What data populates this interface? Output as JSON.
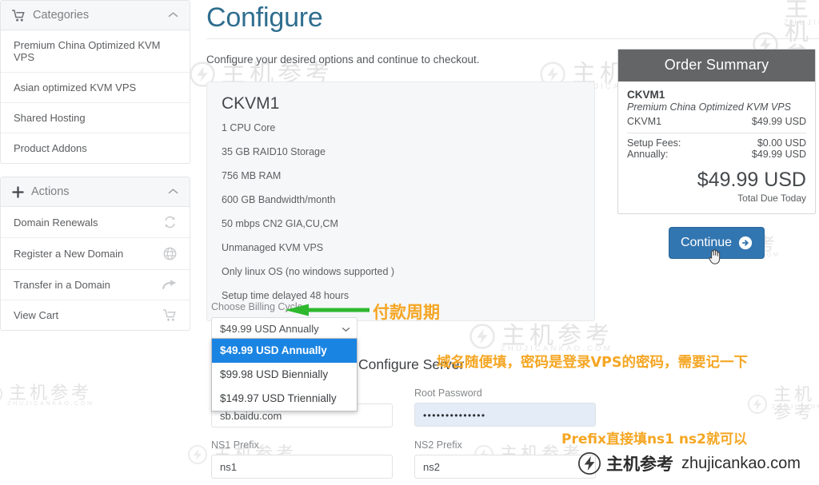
{
  "page": {
    "title": "Configure",
    "subtitle": "Configure your desired options and continue to checkout."
  },
  "sidebar": {
    "categories": {
      "header": "Categories",
      "icon": "cart-icon",
      "collapse_icon": "chevron-up-icon",
      "items": [
        {
          "label": "Premium China Optimized KVM VPS",
          "icon": ""
        },
        {
          "label": "Asian optimized KVM VPS",
          "icon": ""
        },
        {
          "label": "Shared Hosting",
          "icon": ""
        },
        {
          "label": "Product Addons",
          "icon": ""
        }
      ]
    },
    "actions": {
      "header": "Actions",
      "icon": "plus-icon",
      "collapse_icon": "chevron-up-icon",
      "items": [
        {
          "label": "Domain Renewals",
          "icon": "refresh-icon"
        },
        {
          "label": "Register a New Domain",
          "icon": "globe-icon"
        },
        {
          "label": "Transfer in a Domain",
          "icon": "arrow-right-curve-icon"
        },
        {
          "label": "View Cart",
          "icon": "cart-icon"
        }
      ]
    }
  },
  "product": {
    "name": "CKVM1",
    "specs": [
      "1 CPU Core",
      "35 GB RAID10 Storage",
      "756 MB RAM",
      "600 GB Bandwidth/month",
      "50 mbps CN2 GIA,CU,CM",
      "Unmanaged KVM VPS",
      "Only linux OS (no windows supported )",
      "Setup time delayed 48 hours"
    ]
  },
  "billing": {
    "label": "Choose Billing Cycle",
    "selected": "$49.99 USD Annually",
    "caret_icon": "chevron-down-icon",
    "options": [
      "$49.99 USD Annually",
      "$99.98 USD Biennially",
      "$149.97 USD Triennially"
    ]
  },
  "configure_server": {
    "heading": "Configure Server",
    "fields": [
      {
        "name": "hostname",
        "label": "",
        "value": "sb.baidu.com",
        "type": "text"
      },
      {
        "name": "root_password",
        "label": "Root Password",
        "value": "••••••••••••••",
        "type": "password"
      },
      {
        "name": "ns1_prefix",
        "label": "NS1 Prefix",
        "value": "ns1",
        "type": "text"
      },
      {
        "name": "ns2_prefix",
        "label": "NS2 Prefix",
        "value": "ns2",
        "type": "text"
      }
    ]
  },
  "order_summary": {
    "header": "Order Summary",
    "product_title": "CKVM1",
    "product_desc": "Premium China Optimized KVM VPS",
    "line_item_label": "CKVM1",
    "line_item_value": "$49.99 USD",
    "rows": [
      {
        "label": "Setup Fees:",
        "value": "$0.00 USD"
      },
      {
        "label": "Annually:",
        "value": "$49.99 USD"
      }
    ],
    "total": "$49.99 USD",
    "total_label": "Total Due Today",
    "header_bg": "#636567"
  },
  "continue_button": {
    "label": "Continue",
    "icon": "arrow-circle-right-icon",
    "color": "#3276b1"
  },
  "annotations": [
    {
      "id": "billing-cycle-note",
      "text": "付款周期",
      "color": "#f5a623"
    },
    {
      "id": "domain-password-note",
      "text": "域名随便填，密码是登录VPS的密码，需要记一下",
      "color": "#f5a623"
    },
    {
      "id": "prefix-note",
      "text": "Prefix直接填ns1 ns2就可以",
      "color": "#f5a623"
    },
    {
      "id": "green-arrow",
      "text": "",
      "color": "#2eb82e"
    }
  ],
  "watermarks": {
    "cn_text": "主机参考",
    "latin_text": "ZHUJICANKAO.COM",
    "brand_url": "zhujicankao.com",
    "logo_icon": "lightning-circle-icon"
  }
}
